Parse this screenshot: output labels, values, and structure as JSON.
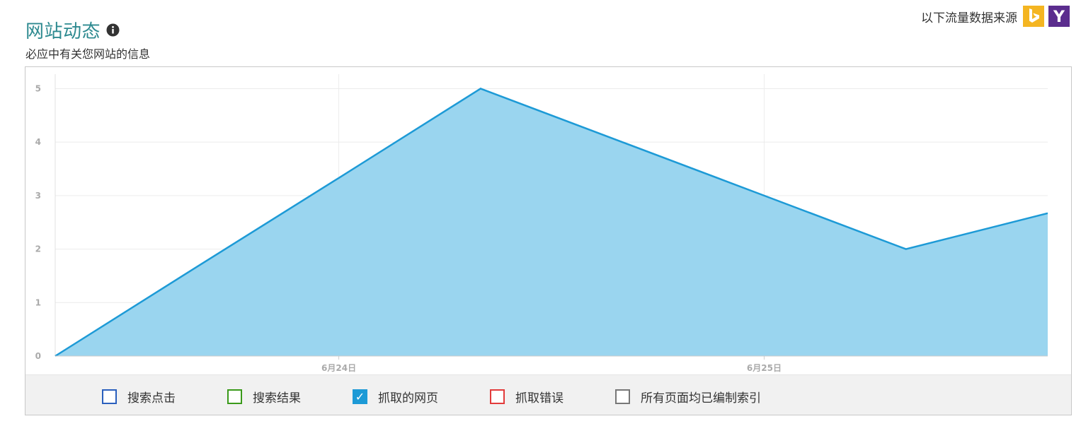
{
  "header": {
    "title": "网站动态",
    "subtitle": "必应中有关您网站的信息",
    "info_icon": "info-circle-icon"
  },
  "source": {
    "label": "以下流量数据来源",
    "logos": [
      "bing-logo-icon",
      "yahoo-logo-icon"
    ],
    "bing_color": "#f4b521",
    "yahoo_color": "#5b2d8e",
    "yahoo_letter": "Y"
  },
  "legend": [
    {
      "label": "搜索点击",
      "checked": false,
      "color": "#2a5fbd"
    },
    {
      "label": "搜索结果",
      "checked": false,
      "color": "#3a9a1a"
    },
    {
      "label": "抓取的网页",
      "checked": true,
      "color": "#1d9ad6",
      "checkmark": "✓"
    },
    {
      "label": "抓取错误",
      "checked": false,
      "color": "#e23b3b"
    },
    {
      "label": "所有页面均已编制索引",
      "checked": false,
      "color": "#777777"
    }
  ],
  "chart_data": {
    "type": "area",
    "x": [
      0,
      1,
      2,
      3,
      4,
      5,
      6,
      7
    ],
    "series": [
      {
        "values": [
          0,
          1.67,
          3.33,
          5,
          4,
          3,
          2,
          2.67
        ],
        "color": "#1d9ad6",
        "fill": "#9ad5ef"
      }
    ],
    "x_ticks": [
      {
        "x": 2,
        "label": "6月24日"
      },
      {
        "x": 5,
        "label": "6月25日"
      }
    ],
    "y_ticks": [
      0,
      1,
      2,
      3,
      4,
      5
    ],
    "xlim": [
      0,
      7
    ],
    "ylim": [
      0,
      5.27
    ],
    "grid": true
  }
}
